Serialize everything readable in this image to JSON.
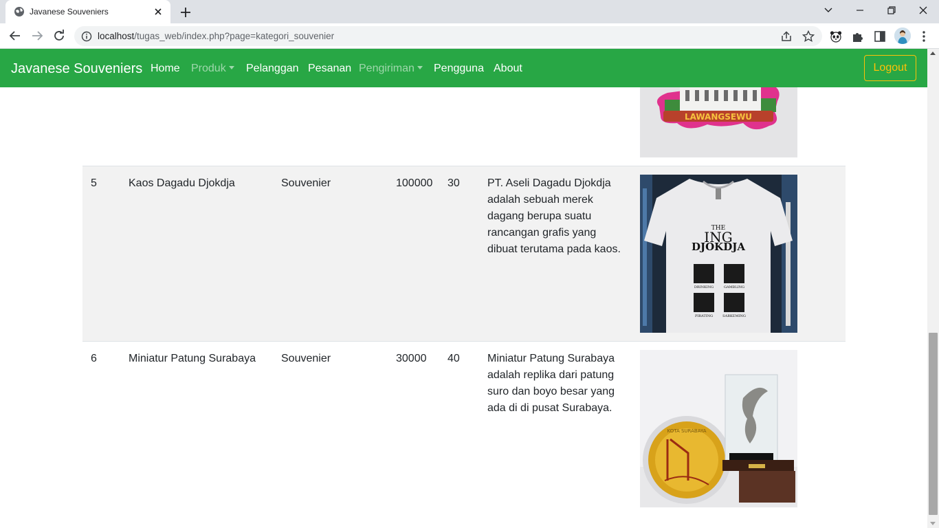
{
  "browser": {
    "tab_title": "Javanese Souveniers",
    "url_host": "localhost",
    "url_path": "/tugas_web/index.php?page=kategori_souvenier"
  },
  "navbar": {
    "brand": "Javanese Souveniers",
    "links": [
      {
        "label": "Home",
        "active": true
      },
      {
        "label": "Produk",
        "dropdown": true,
        "active": false
      },
      {
        "label": "Pelanggan",
        "active": true
      },
      {
        "label": "Pesanan",
        "active": true
      },
      {
        "label": "Pengiriman",
        "dropdown": true,
        "active": false
      },
      {
        "label": "Pengguna",
        "active": true
      },
      {
        "label": "About",
        "active": true
      }
    ],
    "logout": "Logout"
  },
  "table": {
    "rows": [
      {
        "no": "5",
        "name": "Kaos Dagadu Djokdja",
        "category": "Souvenier",
        "price": "100000",
        "stock": "30",
        "description": "PT. Aseli Dagadu Djokdja adalah sebuah merek dagang berupa suatu rancangan grafis yang dibuat terutama pada kaos.",
        "image_text": {
          "top": "THE",
          "big": "ING",
          "name": "DJOKDJA",
          "c1": "DRINKING",
          "c2": "GAMBLING",
          "c3": "PIRATING",
          "c4": "SARKEMING"
        }
      },
      {
        "no": "6",
        "name": "Miniatur Patung Surabaya",
        "category": "Souvenier",
        "price": "30000",
        "stock": "40",
        "description": "Miniatur Patung Surabaya adalah replika dari patung suro dan boyo besar yang ada di di pusat Surabaya.",
        "image_text": {
          "coin": "KOTA SURABAYA"
        }
      }
    ],
    "prev_image_text": "LAWANGSEWU"
  },
  "colors": {
    "navbar": "#28a745",
    "logout": "#ffc107",
    "stripe": "#f2f2f2"
  }
}
